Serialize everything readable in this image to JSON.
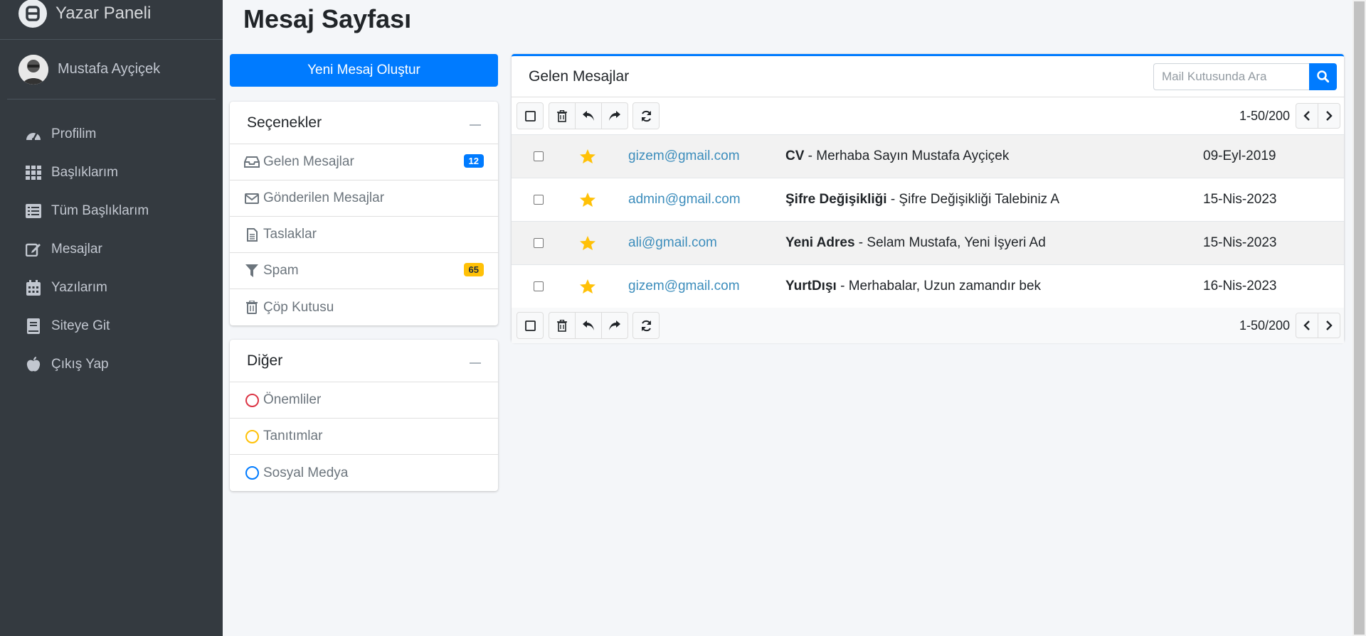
{
  "sidebar": {
    "brand": "Yazar Paneli",
    "user_name": "Mustafa Ayçiçek",
    "items": [
      {
        "label": "Profilim",
        "icon": "dashboard-icon"
      },
      {
        "label": "Başlıklarım",
        "icon": "grid-icon"
      },
      {
        "label": "Tüm Başlıklarım",
        "icon": "list-icon"
      },
      {
        "label": "Mesajlar",
        "icon": "edit-icon"
      },
      {
        "label": "Yazılarım",
        "icon": "calendar-icon"
      },
      {
        "label": "Siteye Git",
        "icon": "book-icon"
      },
      {
        "label": "Çıkış Yap",
        "icon": "apple-icon"
      }
    ]
  },
  "page": {
    "title": "Mesaj Sayfası",
    "compose_label": "Yeni Mesaj Oluştur"
  },
  "options": {
    "title": "Seçenekler",
    "items": [
      {
        "label": "Gelen Mesajlar",
        "icon": "inbox-icon",
        "badge": "12"
      },
      {
        "label": "Gönderilen Mesajlar",
        "icon": "envelope-icon"
      },
      {
        "label": "Taslaklar",
        "icon": "file-icon"
      },
      {
        "label": "Spam",
        "icon": "filter-icon",
        "badge": "65"
      },
      {
        "label": "Çöp Kutusu",
        "icon": "trash-icon"
      }
    ]
  },
  "other": {
    "title": "Diğer",
    "items": [
      {
        "label": "Önemliler",
        "color": "#dc3545"
      },
      {
        "label": "Tanıtımlar",
        "color": "#ffc107"
      },
      {
        "label": "Sosyal Medya",
        "color": "#007bff"
      }
    ]
  },
  "mailbox": {
    "title": "Gelen Mesajlar",
    "search_placeholder": "Mail Kutusunda Ara",
    "pager_text": "1-50/200",
    "messages": [
      {
        "from": "gizem@gmail.com",
        "subject": "CV",
        "preview": " - Merhaba Sayın Mustafa Ayçiçek",
        "date": "09-Eyl-2019",
        "starred": true
      },
      {
        "from": "admin@gmail.com",
        "subject": "Şifre Değişikliği",
        "preview": " - Şifre Değişikliği Talebiniz A",
        "date": "15-Nis-2023",
        "starred": true
      },
      {
        "from": "ali@gmail.com",
        "subject": "Yeni Adres",
        "preview": " - Selam Mustafa, Yeni İşyeri Ad",
        "date": "15-Nis-2023",
        "starred": true
      },
      {
        "from": "gizem@gmail.com",
        "subject": "YurtDışı",
        "preview": " - Merhabalar, Uzun zamandır bek",
        "date": "16-Nis-2023",
        "starred": true
      }
    ]
  },
  "colors": {
    "accent": "#007bff",
    "sidebar_bg": "#343a40",
    "star": "#ffc107",
    "link": "#3c8dbc"
  }
}
